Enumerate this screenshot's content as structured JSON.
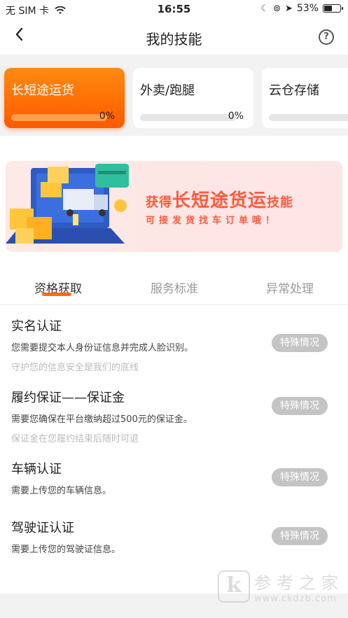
{
  "statusbar": {
    "carrier": "无 SIM 卡",
    "time": "16:55",
    "battery": "53%",
    "battery_level": 0.53
  },
  "nav": {
    "title": "我的技能",
    "back_icon": "chevron-left-icon",
    "help_icon": "help-circle-icon"
  },
  "skills": [
    {
      "label": "长短途运货",
      "progress": "0%",
      "active": true
    },
    {
      "label": "外卖/跑腿",
      "progress": "0%",
      "active": false
    },
    {
      "label": "云仓存储",
      "progress": "0%",
      "active": false
    }
  ],
  "banner": {
    "prefix": "获得",
    "highlight": "长短途货运",
    "suffix": "技能",
    "subtitle": "可接发货找车订单哦！"
  },
  "tabs": [
    "资格获取",
    "服务标准",
    "异常处理"
  ],
  "colors": {
    "accent": "#ff6a1a",
    "accent_gradient_top": "#ff8a10",
    "banner_text": "#ff5a3c",
    "badge_gray": "#c4c4c4"
  },
  "requirements": [
    {
      "title": "实名认证",
      "desc": "您需要提交本人身份证信息并完成人脸识别。",
      "note": "守护您的信息安全是我们的底线",
      "button": "特殊情况"
    },
    {
      "title": "履约保证——保证金",
      "desc": "需要您确保在平台缴纳超过500元的保证金。",
      "note": "保证金在您履约结束后随时可退",
      "button": "特殊情况"
    },
    {
      "title": "车辆认证",
      "desc": "需要上传您的车辆信息。",
      "note": "",
      "button": "特殊情况"
    },
    {
      "title": "驾驶证认证",
      "desc": "需要上传您的驾驶证信息。",
      "note": "",
      "button": "特殊情况"
    }
  ],
  "watermark": {
    "logo": "k",
    "name": "参考之家",
    "url": "www.ckdzb.com"
  }
}
